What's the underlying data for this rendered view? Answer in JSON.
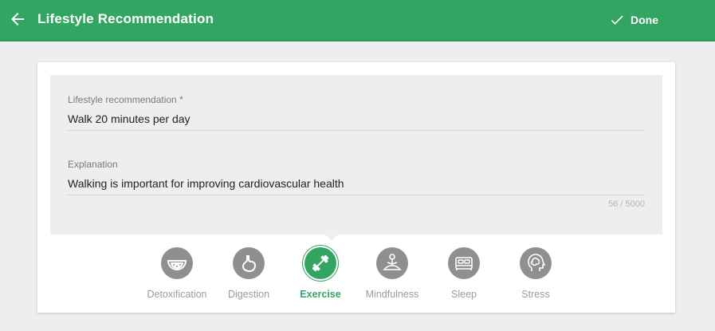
{
  "header": {
    "title": "Lifestyle Recommendation",
    "done_label": "Done",
    "bg_color": "#33a562"
  },
  "form": {
    "recommendation_label": "Lifestyle recommendation *",
    "recommendation_value": "Walk 20 minutes per day",
    "explanation_label": "Explanation",
    "explanation_value": "Walking is important for improving cardiovascular health",
    "char_counter": "56 / 5000"
  },
  "categories": [
    {
      "label": "Detoxification",
      "icon": "watermelon-icon",
      "active": false
    },
    {
      "label": "Digestion",
      "icon": "stomach-icon",
      "active": false
    },
    {
      "label": "Exercise",
      "icon": "dumbbell-icon",
      "active": true
    },
    {
      "label": "Mindfulness",
      "icon": "meditation-icon",
      "active": false
    },
    {
      "label": "Sleep",
      "icon": "bed-icon",
      "active": false
    },
    {
      "label": "Stress",
      "icon": "head-brain-icon",
      "active": false
    }
  ]
}
